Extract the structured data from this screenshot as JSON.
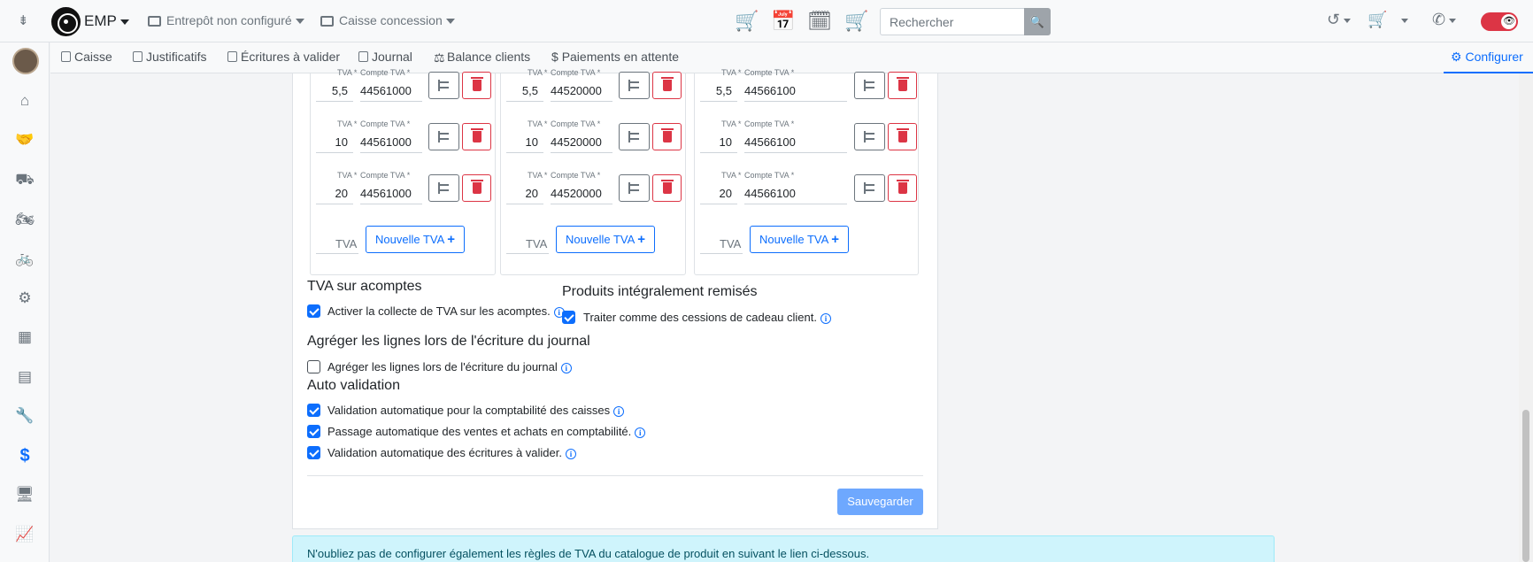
{
  "topbar": {
    "brand": "EMP",
    "warehouse": "Entrepôt non configuré",
    "cashdesk": "Caisse concession",
    "search_placeholder": "Rechercher",
    "icons": [
      "cart-icon",
      "calendar-moto-icon",
      "calendar-tools-icon",
      "cart-moto-icon"
    ]
  },
  "subnav": {
    "items": [
      "Caisse",
      "Justificatifs",
      "Écritures à valider",
      "Journal",
      "Balance clients",
      "Paiements en attente"
    ],
    "configure": "Configurer"
  },
  "tva_columns": [
    {
      "rows": [
        {
          "tva": "5,5",
          "compte": "44561000"
        },
        {
          "tva": "10",
          "compte": "44561000"
        },
        {
          "tva": "20",
          "compte": "44561000"
        }
      ]
    },
    {
      "rows": [
        {
          "tva": "5,5",
          "compte": "44520000"
        },
        {
          "tva": "10",
          "compte": "44520000"
        },
        {
          "tva": "20",
          "compte": "44520000"
        }
      ]
    },
    {
      "rows": [
        {
          "tva": "5,5",
          "compte": "44566100"
        },
        {
          "tva": "10",
          "compte": "44566100"
        },
        {
          "tva": "20",
          "compte": "44566100"
        }
      ]
    }
  ],
  "labels": {
    "tva": "TVA *",
    "compte": "Compte TVA *",
    "new_tva_label": "TVA",
    "new_tva_button": "Nouvelle TVA"
  },
  "sections": {
    "acomptes_title": "TVA sur acomptes",
    "acomptes_chk": "Activer la collecte de TVA sur les acomptes.",
    "remises_title": "Produits intégralement remisés",
    "remises_chk": "Traiter comme des cessions de cadeau client.",
    "agreger_title": "Agréger les lignes lors de l'écriture du journal",
    "agreger_chk": "Agréger les lignes lors de l'écriture du journal",
    "auto_title": "Auto validation",
    "auto_chk1": "Validation automatique pour la comptabilité des caisses",
    "auto_chk2": "Passage automatique des ventes et achats en comptabilité.",
    "auto_chk3": "Validation automatique des écritures à valider."
  },
  "checkboxes": {
    "acomptes": true,
    "remises": true,
    "agreger": false,
    "auto1": true,
    "auto2": true,
    "auto3": true
  },
  "save_button": "Sauvegarder",
  "alert": "N'oubliez pas de configurer également les règles de TVA du catalogue de produit en suivant le lien ci-dessous.",
  "colors": {
    "primary": "#0d6efd",
    "danger": "#dc3545",
    "alert_bg": "#cff4fc"
  }
}
